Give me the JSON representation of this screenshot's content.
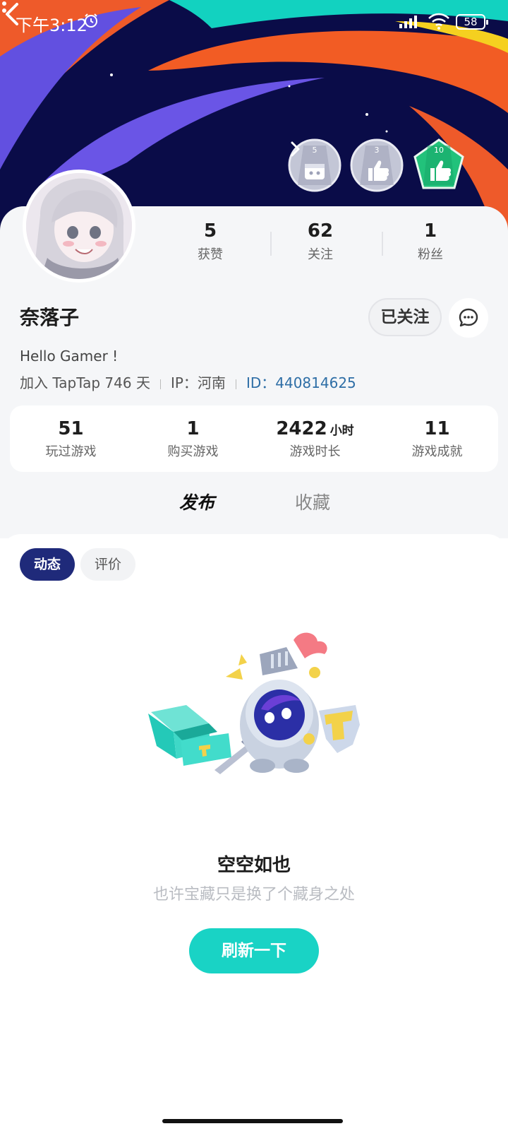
{
  "status_bar": {
    "time": "下午3:12",
    "battery": "58",
    "icons": [
      "alarm-icon",
      "signal-icon",
      "wifi-icon",
      "battery-icon"
    ]
  },
  "header": {
    "back_icon": "chevron-left-icon",
    "more_icon": "more-vertical-icon",
    "badges": [
      {
        "number": "5",
        "icon": "gamepad-calendar-icon",
        "color": "#c3c6d6"
      },
      {
        "number": "3",
        "icon": "thumbs-up-icon",
        "color": "#c3c6d6"
      },
      {
        "number": "10",
        "icon": "thumbs-up-icon",
        "color": "#22c27b"
      }
    ]
  },
  "profile": {
    "stats": [
      {
        "value": "5",
        "label": "获赞"
      },
      {
        "value": "62",
        "label": "关注"
      },
      {
        "value": "1",
        "label": "粉丝"
      }
    ],
    "username": "奈落子",
    "follow_label": "已关注",
    "bio": "Hello Gamer !",
    "join_text": "加入 TapTap 746 天",
    "ip_text": "IP：河南",
    "id_label": "ID：",
    "id_value": "440814625"
  },
  "game_stats": [
    {
      "value": "51",
      "unit": "",
      "label": "玩过游戏"
    },
    {
      "value": "1",
      "unit": "",
      "label": "购买游戏"
    },
    {
      "value": "2422",
      "unit": "小时",
      "label": "游戏时长"
    },
    {
      "value": "11",
      "unit": "",
      "label": "游戏成就"
    }
  ],
  "tabs": {
    "active": "发布",
    "inactive": "收藏"
  },
  "chips": {
    "active": "动态",
    "inactive": "评价"
  },
  "empty_state": {
    "title": "空空如也",
    "subtitle": "也许宝藏只是换了个藏身之处",
    "button": "刷新一下"
  },
  "colors": {
    "accent": "#19d3c5",
    "chip_active": "#1f2a7a",
    "id_link": "#2e6ea6"
  }
}
